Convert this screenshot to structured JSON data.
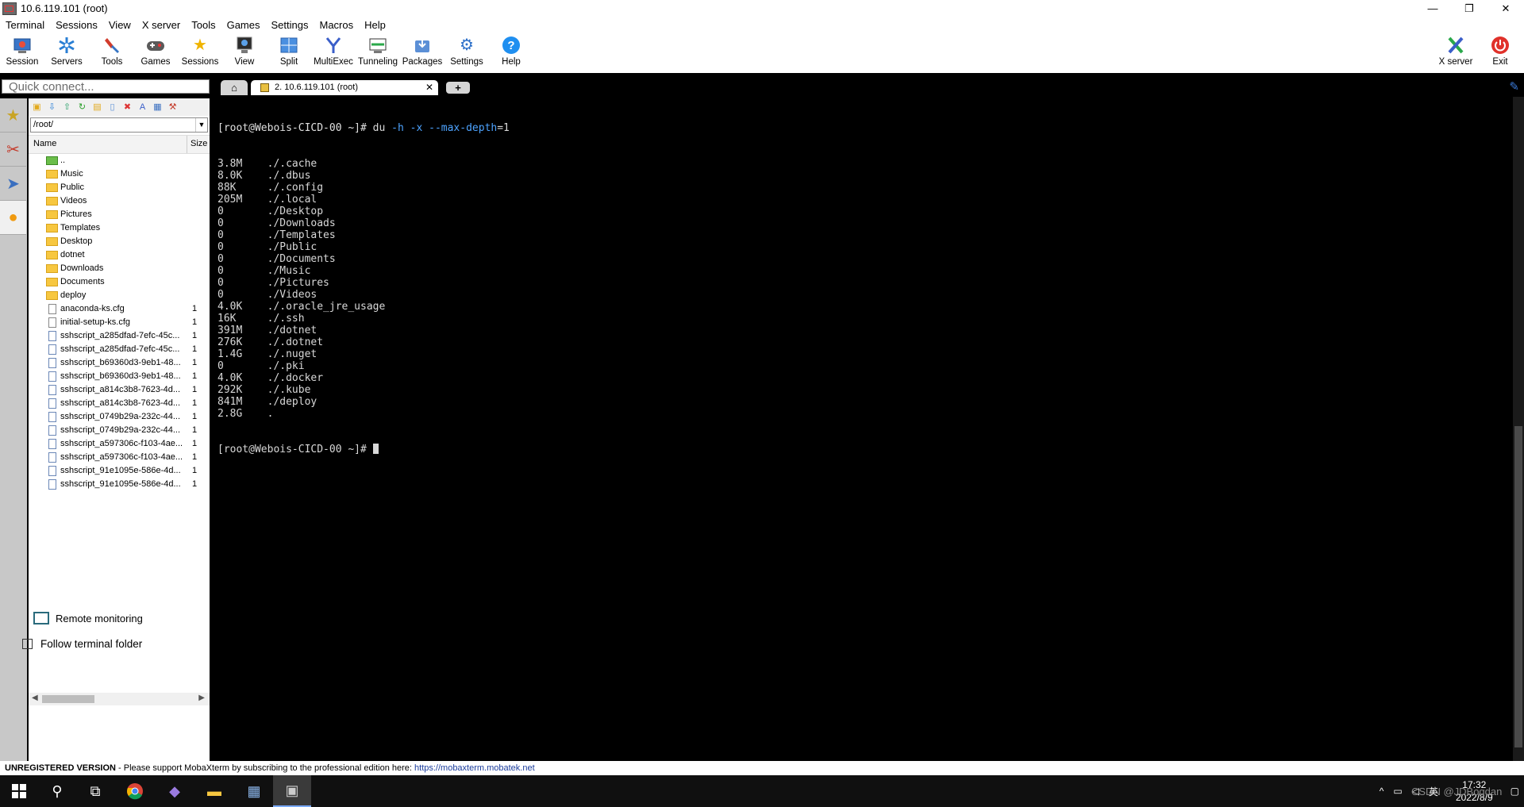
{
  "window": {
    "title": "10.6.119.101 (root)",
    "controls": [
      "—",
      "❐",
      "✕"
    ]
  },
  "menu": [
    "Terminal",
    "Sessions",
    "View",
    "X server",
    "Tools",
    "Games",
    "Settings",
    "Macros",
    "Help"
  ],
  "toolbar": {
    "buttons": [
      {
        "label": "Session",
        "icon": "session-icon"
      },
      {
        "label": "Servers",
        "icon": "servers-icon"
      },
      {
        "label": "Tools",
        "icon": "tools-icon"
      },
      {
        "label": "Games",
        "icon": "games-icon"
      },
      {
        "label": "Sessions",
        "icon": "star-icon"
      },
      {
        "label": "View",
        "icon": "view-icon"
      },
      {
        "label": "Split",
        "icon": "split-icon"
      },
      {
        "label": "MultiExec",
        "icon": "multiexec-icon"
      },
      {
        "label": "Tunneling",
        "icon": "tunneling-icon"
      },
      {
        "label": "Packages",
        "icon": "packages-icon"
      },
      {
        "label": "Settings",
        "icon": "settings-icon"
      },
      {
        "label": "Help",
        "icon": "help-icon"
      }
    ],
    "right_buttons": [
      {
        "label": "X server",
        "icon": "xserver-icon"
      },
      {
        "label": "Exit",
        "icon": "power-icon"
      }
    ]
  },
  "quick_connect": {
    "placeholder": "Quick connect..."
  },
  "sftp": {
    "path": "/root/",
    "columns": {
      "name": "Name",
      "size": "Size"
    },
    "files": [
      {
        "name": "..",
        "type": "up",
        "size": ""
      },
      {
        "name": "Music",
        "type": "folder",
        "size": ""
      },
      {
        "name": "Public",
        "type": "folder",
        "size": ""
      },
      {
        "name": "Videos",
        "type": "folder",
        "size": ""
      },
      {
        "name": "Pictures",
        "type": "folder",
        "size": ""
      },
      {
        "name": "Templates",
        "type": "folder",
        "size": ""
      },
      {
        "name": "Desktop",
        "type": "folder",
        "size": ""
      },
      {
        "name": "dotnet",
        "type": "folder",
        "size": ""
      },
      {
        "name": "Downloads",
        "type": "folder",
        "size": ""
      },
      {
        "name": "Documents",
        "type": "folder",
        "size": ""
      },
      {
        "name": "deploy",
        "type": "folder",
        "size": ""
      },
      {
        "name": "anaconda-ks.cfg",
        "type": "cfg",
        "size": "1"
      },
      {
        "name": "initial-setup-ks.cfg",
        "type": "cfg",
        "size": "1"
      },
      {
        "name": "sshscript_a285dfad-7efc-45c...",
        "type": "file",
        "size": "1"
      },
      {
        "name": "sshscript_a285dfad-7efc-45c...",
        "type": "file",
        "size": "1"
      },
      {
        "name": "sshscript_b69360d3-9eb1-48...",
        "type": "file",
        "size": "1"
      },
      {
        "name": "sshscript_b69360d3-9eb1-48...",
        "type": "file",
        "size": "1"
      },
      {
        "name": "sshscript_a814c3b8-7623-4d...",
        "type": "file",
        "size": "1"
      },
      {
        "name": "sshscript_a814c3b8-7623-4d...",
        "type": "file",
        "size": "1"
      },
      {
        "name": "sshscript_0749b29a-232c-44...",
        "type": "file",
        "size": "1"
      },
      {
        "name": "sshscript_0749b29a-232c-44...",
        "type": "file",
        "size": "1"
      },
      {
        "name": "sshscript_a597306c-f103-4ae...",
        "type": "file",
        "size": "1"
      },
      {
        "name": "sshscript_a597306c-f103-4ae...",
        "type": "file",
        "size": "1"
      },
      {
        "name": "sshscript_91e1095e-586e-4d...",
        "type": "file",
        "size": "1"
      },
      {
        "name": "sshscript_91e1095e-586e-4d...",
        "type": "file",
        "size": "1"
      }
    ],
    "remote_monitoring": "Remote monitoring",
    "follow_terminal": "Follow terminal folder"
  },
  "tabs": {
    "home_icon": "home-icon",
    "session_tab": "2. 10.6.119.101 (root)",
    "close": "✕",
    "new_tab": "+"
  },
  "terminal": {
    "prompt": "[root@Webois-CICD-00 ~]# ",
    "command": "du",
    "flag1": "-h",
    "flag2": "-x",
    "flag3": "--max-depth",
    "flag3_val": "=1",
    "output": [
      "3.8M    ./.cache",
      "8.0K    ./.dbus",
      "88K     ./.config",
      "205M    ./.local",
      "0       ./Desktop",
      "0       ./Downloads",
      "0       ./Templates",
      "0       ./Public",
      "0       ./Documents",
      "0       ./Music",
      "0       ./Pictures",
      "0       ./Videos",
      "4.0K    ./.oracle_jre_usage",
      "16K     ./.ssh",
      "391M    ./dotnet",
      "276K    ./.dotnet",
      "1.4G    ./.nuget",
      "0       ./.pki",
      "4.0K    ./.docker",
      "292K    ./.kube",
      "841M    ./deploy",
      "2.8G    ."
    ],
    "final_prompt": "[root@Webois-CICD-00 ~]# "
  },
  "status": {
    "unregistered": "UNREGISTERED VERSION",
    "message": " -  Please support MobaXterm by subscribing to the professional edition here: ",
    "link": "https://mobaxterm.mobatek.net"
  },
  "taskbar": {
    "time": "17:32",
    "date": "2022/8/9",
    "ime": "英",
    "watermark": "CSDN @JDBogdan"
  }
}
